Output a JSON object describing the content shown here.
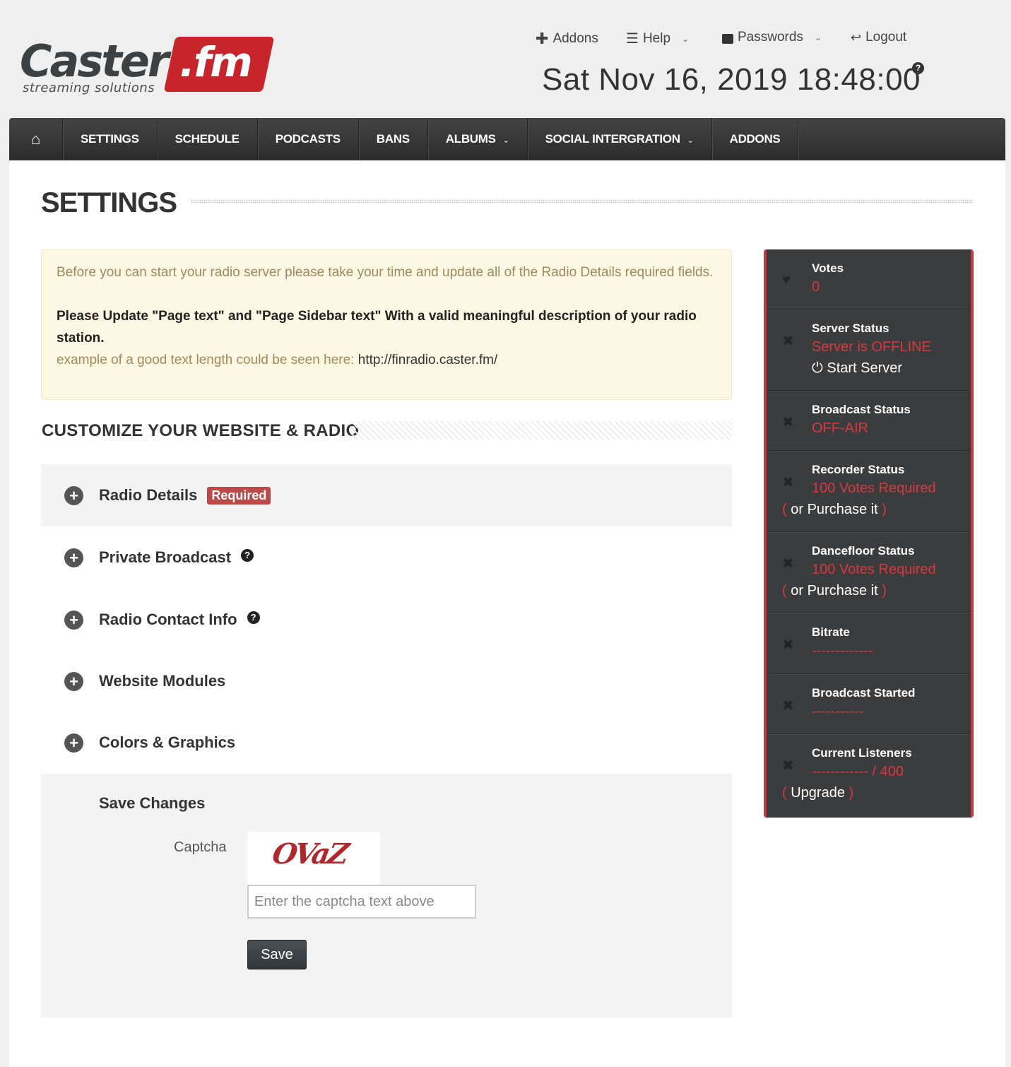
{
  "brand": {
    "name": "Caster",
    "suffix": ".fm",
    "tagline": "streaming solutions",
    "accent": "#c8242b"
  },
  "topnav": {
    "addons": "Addons",
    "help": "Help",
    "passwords": "Passwords",
    "logout": "Logout"
  },
  "datetime": "Sat Nov 16, 2019 18:48:00",
  "mainnav": {
    "settings": "SETTINGS",
    "schedule": "SCHEDULE",
    "podcasts": "PODCASTS",
    "bans": "BANS",
    "albums": "ALBUMS",
    "social": "SOCIAL INTERGRATION",
    "addons": "ADDONS"
  },
  "page": {
    "title": "SETTINGS"
  },
  "alert": {
    "line1": "Before you can start your radio server please take your time and update all of the Radio Details required fields.",
    "strong": "Please Update \"Page text\" and \"Page Sidebar text\" With a valid meaningful description of your radio station.",
    "example_prefix": "example of a good text length could be seen here:",
    "example_link": "http://finradio.caster.fm/"
  },
  "customize": {
    "title": "CUSTOMIZE YOUR WEBSITE & RADIO",
    "sections": [
      {
        "label": "Radio Details",
        "badge": "Required"
      },
      {
        "label": "Private Broadcast"
      },
      {
        "label": "Radio Contact Info"
      },
      {
        "label": "Website Modules"
      },
      {
        "label": "Colors & Graphics"
      }
    ]
  },
  "save": {
    "title": "Save Changes",
    "captcha_label": "Captcha",
    "captcha_text": "OVaZ",
    "captcha_placeholder": "Enter the captcha text above",
    "button": "Save"
  },
  "sidebar": {
    "votes": {
      "label": "Votes",
      "value": "0"
    },
    "server": {
      "label": "Server Status",
      "value": "Server is OFFLINE",
      "action": "Start Server"
    },
    "broadcast": {
      "label": "Broadcast Status",
      "value": "OFF-AIR"
    },
    "recorder": {
      "label": "Recorder Status",
      "value": "100 Votes Required",
      "extra": "or Purchase it"
    },
    "dancefloor": {
      "label": "Dancefloor Status",
      "value": "100 Votes Required",
      "extra": "or Purchase it"
    },
    "bitrate": {
      "label": "Bitrate",
      "value": "-------------"
    },
    "started": {
      "label": "Broadcast Started",
      "value": "-----------"
    },
    "listeners": {
      "label": "Current Listeners",
      "value": "------------ / 400",
      "extra": "Upgrade"
    }
  }
}
